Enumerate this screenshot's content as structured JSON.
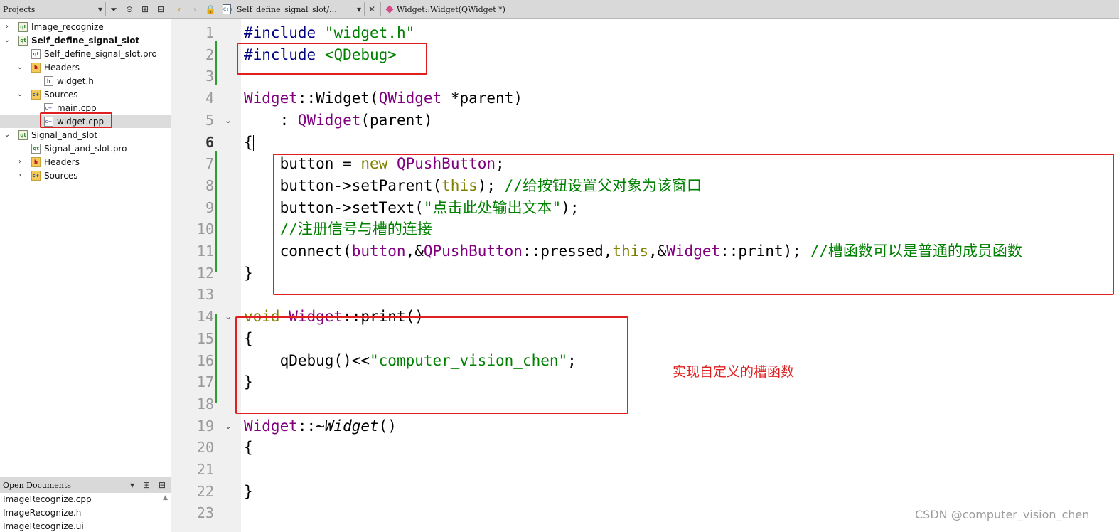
{
  "toolbar": {
    "projects_label": "Projects",
    "open_file": "Self_define_signal_slot/…",
    "function_crumb": "Widget::Widget(QWidget *)"
  },
  "tree": [
    {
      "label": "Image_recognize",
      "level": 0,
      "arrow": "›",
      "icon": "proj",
      "bold": false
    },
    {
      "label": "Self_define_signal_slot",
      "level": 0,
      "arrow": "⌄",
      "icon": "proj",
      "bold": true
    },
    {
      "label": "Self_define_signal_slot.pro",
      "level": 1,
      "arrow": "",
      "icon": "pro",
      "bold": false
    },
    {
      "label": "Headers",
      "level": 1,
      "arrow": "⌄",
      "icon": "folder",
      "bold": false
    },
    {
      "label": "widget.h",
      "level": 2,
      "arrow": "",
      "icon": "hfile",
      "bold": false
    },
    {
      "label": "Sources",
      "level": 1,
      "arrow": "⌄",
      "icon": "folder-s",
      "bold": false
    },
    {
      "label": "main.cpp",
      "level": 2,
      "arrow": "",
      "icon": "file",
      "bold": false
    },
    {
      "label": "widget.cpp",
      "level": 2,
      "arrow": "",
      "icon": "file",
      "bold": false,
      "selected": true
    },
    {
      "label": "Signal_and_slot",
      "level": 0,
      "arrow": "⌄",
      "icon": "proj",
      "bold": false
    },
    {
      "label": "Signal_and_slot.pro",
      "level": 1,
      "arrow": "",
      "icon": "pro",
      "bold": false
    },
    {
      "label": "Headers",
      "level": 1,
      "arrow": "›",
      "icon": "folder",
      "bold": false
    },
    {
      "label": "Sources",
      "level": 1,
      "arrow": "›",
      "icon": "folder-s",
      "bold": false
    }
  ],
  "open_documents": {
    "title": "Open Documents",
    "items": [
      "ImageRecognize.cpp",
      "ImageRecognize.h",
      "ImageRecognize.ui"
    ]
  },
  "code": {
    "current_line": 6,
    "lines": [
      [
        [
          "#include ",
          "pre"
        ],
        [
          "\"widget.h\"",
          "str"
        ]
      ],
      [
        [
          "#include ",
          "pre"
        ],
        [
          "<QDebug>",
          "str"
        ]
      ],
      [],
      [
        [
          "Widget",
          "type"
        ],
        [
          "::",
          ""
        ],
        [
          "Widget",
          ""
        ],
        [
          "(",
          ""
        ],
        [
          "QWidget",
          "type"
        ],
        [
          " *parent)",
          ""
        ]
      ],
      [
        [
          "    : ",
          ""
        ],
        [
          "QWidget",
          "type"
        ],
        [
          "(parent)",
          ""
        ]
      ],
      [
        [
          "{",
          ""
        ],
        [
          "|",
          "caret"
        ]
      ],
      [
        [
          "    button = ",
          ""
        ],
        [
          "new",
          "kw"
        ],
        [
          " ",
          ""
        ],
        [
          "QPushButton",
          "type"
        ],
        [
          ";",
          ""
        ]
      ],
      [
        [
          "    button->setParent(",
          ""
        ],
        [
          "this",
          "kw"
        ],
        [
          "); ",
          ""
        ],
        [
          "//给按钮设置父对象为该窗口",
          "com"
        ]
      ],
      [
        [
          "    button->setText(",
          ""
        ],
        [
          "\"点击此处输出文本\"",
          "str"
        ],
        [
          ");",
          ""
        ]
      ],
      [
        [
          "    ",
          ""
        ],
        [
          "//注册信号与槽的连接",
          "com"
        ]
      ],
      [
        [
          "    connect(",
          ""
        ],
        [
          "button",
          "type"
        ],
        [
          ",&",
          ""
        ],
        [
          "QPushButton",
          "type"
        ],
        [
          "::pressed,",
          ""
        ],
        [
          "this",
          "kw"
        ],
        [
          ",&",
          ""
        ],
        [
          "Widget",
          "type"
        ],
        [
          "::print); ",
          ""
        ],
        [
          "//槽函数可以是普通的成员函数",
          "com"
        ]
      ],
      [
        [
          "}",
          ""
        ]
      ],
      [],
      [
        [
          "void",
          "kw"
        ],
        [
          " ",
          ""
        ],
        [
          "Widget",
          "type"
        ],
        [
          "::print()",
          ""
        ]
      ],
      [
        [
          "{",
          ""
        ]
      ],
      [
        [
          "    qDebug()<<",
          ""
        ],
        [
          "\"computer_vision_chen\"",
          "str"
        ],
        [
          ";",
          ""
        ]
      ],
      [
        [
          "}",
          ""
        ]
      ],
      [],
      [
        [
          "Widget",
          "type"
        ],
        [
          "::~",
          ""
        ],
        [
          "Widget",
          "it"
        ],
        [
          "()",
          ""
        ]
      ],
      [
        [
          "{",
          ""
        ]
      ],
      [],
      [
        [
          "}",
          ""
        ]
      ],
      []
    ],
    "fold_lines": [
      5,
      14,
      19
    ]
  },
  "annotation": "实现自定义的槽函数",
  "watermark": "CSDN @computer_vision_chen"
}
